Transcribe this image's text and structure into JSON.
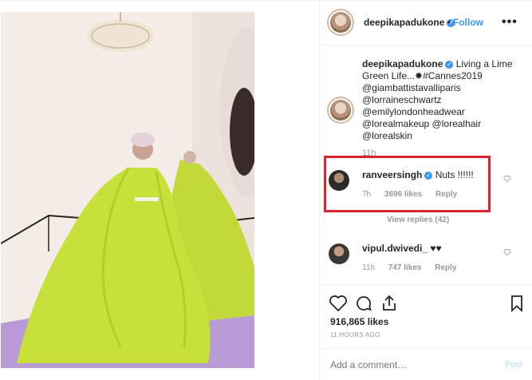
{
  "header": {
    "username": "deepikapadukone",
    "separator": "•",
    "follow_label": "Follow",
    "verified_glyph": "✓",
    "more_icon": "more-options-icon"
  },
  "caption": {
    "username": "deepikapadukone",
    "text": "Living a Lime Green Life...✸#Cannes2019 @giambattistavalliparis @lorraineschwartz @emilylondonheadwear @lorealmakeup @lorealhair @lorealskin",
    "time": "11h"
  },
  "comments": [
    {
      "username": "ranveersingh",
      "text": "Nuts !!!!!!",
      "time": "7h",
      "likes": "3696 likes",
      "reply_label": "Reply",
      "verified": true
    },
    {
      "username": "vipul.dwivedi_",
      "text": "♥♥",
      "time": "11h",
      "likes": "747 likes",
      "reply_label": "Reply",
      "verified": false
    }
  ],
  "view_replies": "View replies (42)",
  "actions": {
    "icons": [
      "heart-icon",
      "comment-icon",
      "share-icon",
      "bookmark-icon"
    ],
    "likes": "916,865 likes",
    "post_time": "11 HOURS AGO"
  },
  "add_comment": {
    "placeholder": "Add a comment…",
    "post_label": "Post"
  },
  "colors": {
    "accent": "#3897f0",
    "highlight": "#d9252f",
    "dress": "#c8e03a",
    "wall": "#f2ece8",
    "floor": "#b89ad6"
  }
}
